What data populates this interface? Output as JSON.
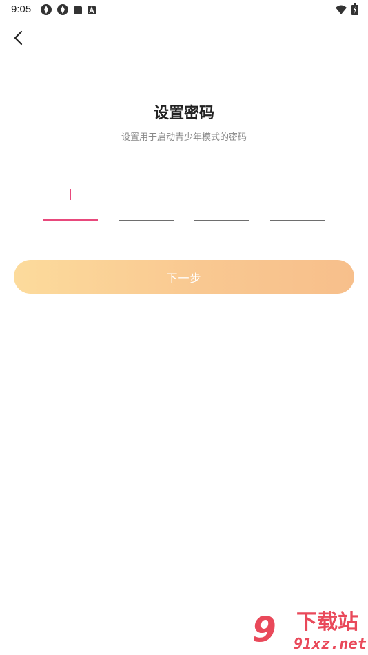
{
  "status_bar": {
    "time": "9:05",
    "left_icons": [
      "aperture-icon",
      "aperture-icon",
      "square-icon",
      "font-a-icon"
    ],
    "right_icons": [
      "wifi-icon",
      "battery-charging-icon"
    ]
  },
  "nav": {
    "back_icon": "chevron-left-icon"
  },
  "title": "设置密码",
  "subtitle": "设置用于启动青少年模式的密码",
  "pin": {
    "length": 4,
    "active_index": 0,
    "active_color": "#e8497c",
    "inactive_color": "#6e6e6e"
  },
  "next_button": {
    "label": "下一步",
    "gradient_start": "#fcdb9c",
    "gradient_end": "#f7bf8b"
  },
  "watermark": {
    "logo_glyph": "9",
    "brand_top": "下载站",
    "brand_bottom": "91xz.net",
    "color": "#e9495a"
  }
}
